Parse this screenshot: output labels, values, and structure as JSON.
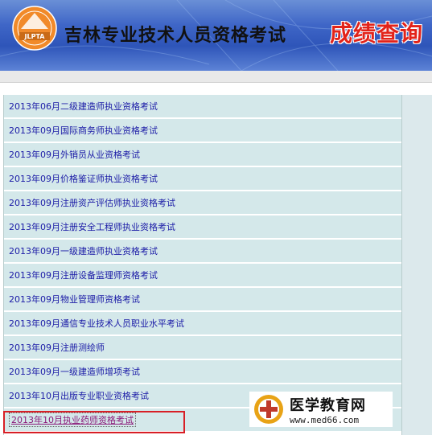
{
  "header": {
    "logo_text": "JLPTA",
    "title": "吉林专业技术人员资格考试",
    "query": "成绩查询"
  },
  "list": {
    "items": [
      "2013年06月二级建造师执业资格考试",
      "2013年09月国际商务师执业资格考试",
      "2013年09月外销员从业资格考试",
      "2013年09月价格鉴证师执业资格考试",
      "2013年09月注册资产评估师执业资格考试",
      "2013年09月注册安全工程师执业资格考试",
      "2013年09月一级建造师执业资格考试",
      "2013年09月注册设备监理师资格考试",
      "2013年09月物业管理师资格考试",
      "2013年09月通信专业技术人员职业水平考试",
      "2013年09月注册测绘师",
      "2013年09月一级建造师增项考试",
      "2013年10月出版专业职业资格考试",
      "2013年10月执业药师资格考试"
    ],
    "highlighted_index": 13
  },
  "watermark": {
    "name": "医学教育网",
    "url": "www.med66.com"
  },
  "colors": {
    "header_blue": "#3f66c7",
    "query_red": "#e2231a",
    "row_bg": "#d4e8ea",
    "link_blue": "#1a1aa6",
    "highlight_box": "#d81f26"
  }
}
